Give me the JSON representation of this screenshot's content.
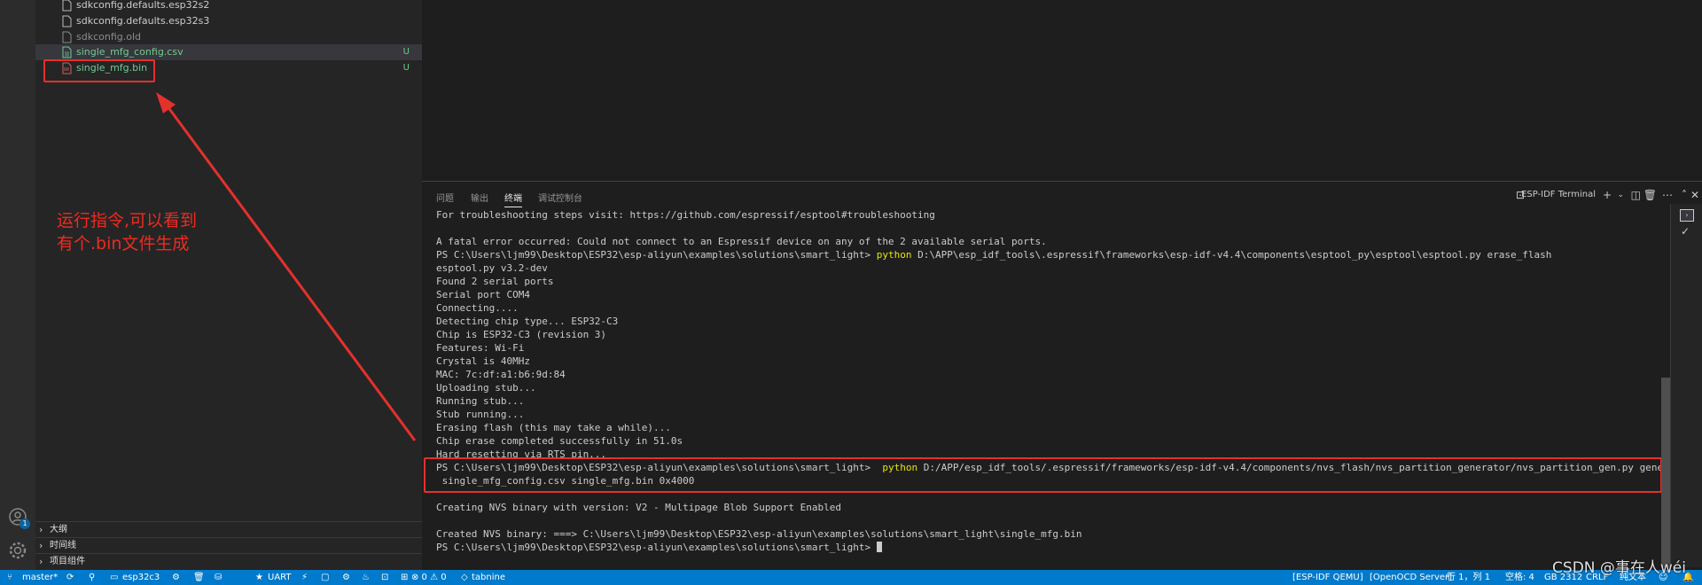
{
  "explorer": {
    "files": [
      {
        "name": "sdkconfig.defaults.esp32s2",
        "status": "",
        "color": "#cccccc"
      },
      {
        "name": "sdkconfig.defaults.esp32s3",
        "status": "",
        "color": "#cccccc"
      },
      {
        "name": "sdkconfig.old",
        "status": "",
        "color": "#8c8c8c"
      },
      {
        "name": "single_mfg_config.csv",
        "status": "U",
        "color": "#73c991"
      },
      {
        "name": "single_mfg.bin",
        "status": "U",
        "color": "#73c991"
      }
    ],
    "sections": [
      "大纲",
      "时间线",
      "项目组件"
    ]
  },
  "annotation": {
    "line1": "运行指令,可以看到",
    "line2": "有个.bin文件生成",
    "color": "#ee2b1f"
  },
  "panel": {
    "tabs": [
      "问题",
      "输出",
      "终端",
      "调试控制台"
    ],
    "active_tab": "终端",
    "terminal_name": "ESP-IDF Terminal"
  },
  "terminal": {
    "lines": [
      {
        "text": "For troubleshooting steps visit: https://github.com/espressif/esptool#troubleshooting"
      },
      {
        "text": ""
      },
      {
        "text": "A fatal error occurred: Could not connect to an Espressif device on any of the 2 available serial ports."
      },
      {
        "prompt": "PS C:\\Users\\ljm99\\Desktop\\ESP32\\esp-aliyun\\examples\\solutions\\smart_light> ",
        "cmd": "python",
        "text": " D:\\APP\\esp_idf_tools\\.espressif\\frameworks\\esp-idf-v4.4\\components\\esptool_py\\esptool\\esptool.py erase_flash"
      },
      {
        "text": "esptool.py v3.2-dev"
      },
      {
        "text": "Found 2 serial ports"
      },
      {
        "text": "Serial port COM4"
      },
      {
        "text": "Connecting...."
      },
      {
        "text": "Detecting chip type... ESP32-C3"
      },
      {
        "text": "Chip is ESP32-C3 (revision 3)"
      },
      {
        "text": "Features: Wi-Fi"
      },
      {
        "text": "Crystal is 40MHz"
      },
      {
        "text": "MAC: 7c:df:a1:b6:9d:84"
      },
      {
        "text": "Uploading stub..."
      },
      {
        "text": "Running stub..."
      },
      {
        "text": "Stub running..."
      },
      {
        "text": "Erasing flash (this may take a while)..."
      },
      {
        "text": "Chip erase completed successfully in 51.0s"
      },
      {
        "text": "Hard resetting via RTS pin..."
      },
      {
        "prompt": "PS C:\\Users\\ljm99\\Desktop\\ESP32\\esp-aliyun\\examples\\solutions\\smart_light>  ",
        "cmd": "python",
        "text": " D:/APP/esp_idf_tools/.espressif/frameworks/esp-idf-v4.4/components/nvs_flash/nvs_partition_generator/nvs_partition_gen.py generate"
      },
      {
        "text": " single_mfg_config.csv single_mfg.bin 0x4000"
      },
      {
        "text": ""
      },
      {
        "text": "Creating NVS binary with version: V2 - Multipage Blob Support Enabled"
      },
      {
        "text": ""
      },
      {
        "text": "Created NVS binary: ===> C:\\Users\\ljm99\\Desktop\\ESP32\\esp-aliyun\\examples\\solutions\\smart_light\\single_mfg.bin"
      },
      {
        "prompt": "PS C:\\Users\\ljm99\\Desktop\\ESP32\\esp-aliyun\\examples\\solutions\\smart_light> ",
        "cursor": true
      }
    ]
  },
  "statusbar": {
    "branch": "master*",
    "target": "esp32c3",
    "uart": "UART",
    "problems": "⊗ 0 ⚠ 0",
    "tabnine": "tabnine",
    "idf_qemu": "[ESP-IDF QEMU]",
    "openocd": "[OpenOCD Server]",
    "position": "行 1，列 1",
    "spaces": "空格: 4",
    "encoding": "GB 2312",
    "eol": "CRLF",
    "language": "纯文本"
  },
  "watermark": "CSDN @事在人wéi"
}
